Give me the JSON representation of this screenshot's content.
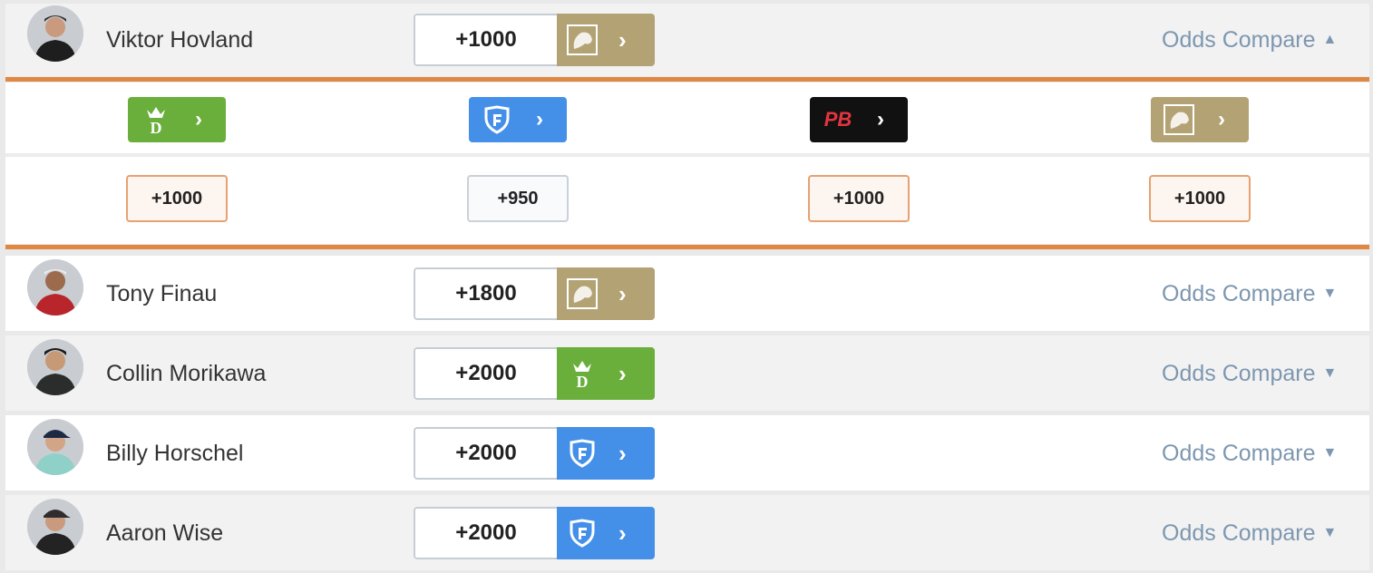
{
  "colors": {
    "accent": "#e08842",
    "draftkings": "#6aae3b",
    "fanduel": "#4490e8",
    "pointsbet": "#111111",
    "betmgm": "#b3a274",
    "link": "#7d97b0"
  },
  "players": [
    {
      "name": "Viktor Hovland",
      "odds": "+1000",
      "book": "BetMGM",
      "book_icon": "betmgm-lion-icon",
      "compare_label": "Odds Compare",
      "chevron": "chevron-up-icon",
      "expanded": true
    },
    {
      "name": "Tony Finau",
      "odds": "+1800",
      "book": "BetMGM",
      "book_icon": "betmgm-lion-icon",
      "compare_label": "Odds Compare",
      "chevron": "chevron-down-icon",
      "expanded": false
    },
    {
      "name": "Collin Morikawa",
      "odds": "+2000",
      "book": "DraftKings",
      "book_icon": "draftkings-crown-icon",
      "compare_label": "Odds Compare",
      "chevron": "chevron-down-icon",
      "expanded": false
    },
    {
      "name": "Billy Horschel",
      "odds": "+2000",
      "book": "FanDuel",
      "book_icon": "fanduel-shield-icon",
      "compare_label": "Odds Compare",
      "chevron": "chevron-down-icon",
      "expanded": false
    },
    {
      "name": "Aaron Wise",
      "odds": "+2000",
      "book": "FanDuel",
      "book_icon": "fanduel-shield-icon",
      "compare_label": "Odds Compare",
      "chevron": "chevron-down-icon",
      "expanded": false
    }
  ],
  "compare": {
    "books": [
      {
        "name": "DraftKings",
        "icon": "draftkings-crown-icon",
        "odds": "+1000",
        "best": true
      },
      {
        "name": "FanDuel",
        "icon": "fanduel-shield-icon",
        "odds": "+950",
        "best": false
      },
      {
        "name": "PointsBet",
        "icon": "pointsbet-logo-icon",
        "odds": "+1000",
        "best": true,
        "logo_text": "PB"
      },
      {
        "name": "BetMGM",
        "icon": "betmgm-lion-icon",
        "odds": "+1000",
        "best": true
      }
    ]
  }
}
